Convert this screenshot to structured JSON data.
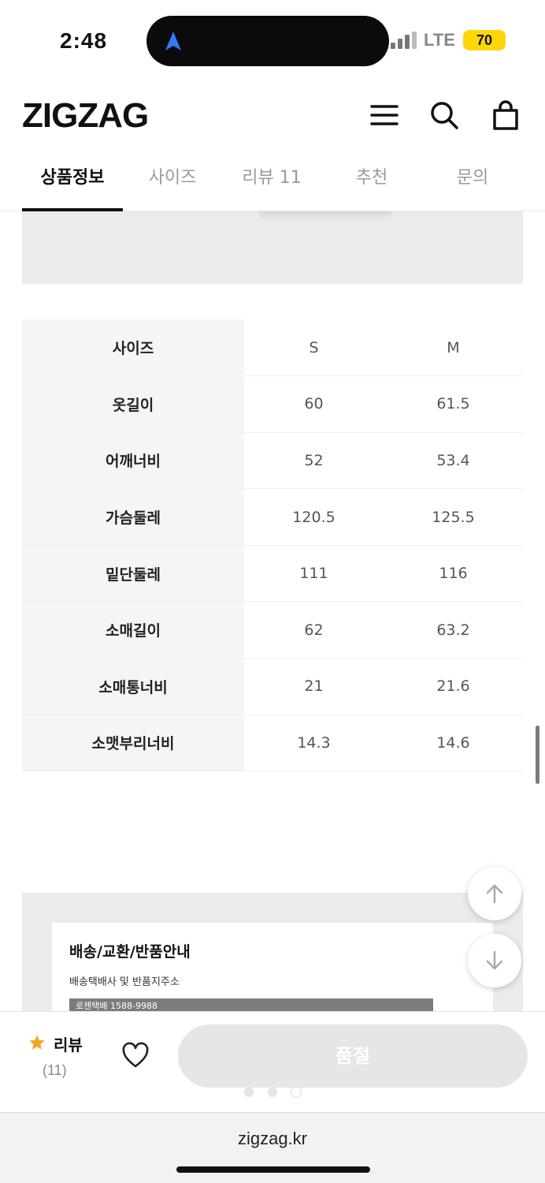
{
  "status_bar": {
    "time": "2:48",
    "carrier": "LTE",
    "battery": "70",
    "icons": [
      "location-arrow-icon",
      "signal-icon",
      "battery-icon"
    ]
  },
  "header": {
    "logo": "ZIGZAG",
    "icons": [
      "menu-icon",
      "search-icon",
      "cart-icon"
    ]
  },
  "tabs": [
    {
      "label": "상품정보",
      "active": true
    },
    {
      "label": "사이즈",
      "active": false
    },
    {
      "label": "리뷰 11",
      "active": false
    },
    {
      "label": "추천",
      "active": false
    },
    {
      "label": "문의",
      "active": false
    }
  ],
  "size_table": {
    "header": {
      "label": "사이즈",
      "s": "S",
      "m": "M"
    },
    "rows": [
      {
        "label": "옷길이",
        "s": "60",
        "m": "61.5"
      },
      {
        "label": "어깨너비",
        "s": "52",
        "m": "53.4"
      },
      {
        "label": "가슴둘레",
        "s": "120.5",
        "m": "125.5"
      },
      {
        "label": "밑단둘레",
        "s": "111",
        "m": "116"
      },
      {
        "label": "소매길이",
        "s": "62",
        "m": "63.2"
      },
      {
        "label": "소매통너비",
        "s": "21",
        "m": "21.6"
      },
      {
        "label": "소맷부리너비",
        "s": "14.3",
        "m": "14.6"
      }
    ]
  },
  "delivery": {
    "title": "배송/교환/반품안내",
    "subtitle": "배송택배사 및 반품지주소",
    "bar_text": "로젠택배 1588-9988"
  },
  "purchase_bar": {
    "review_label": "리뷰",
    "review_count": "(11)",
    "soldout_label": "품절"
  },
  "browser": {
    "url": "zigzag.kr"
  },
  "colors": {
    "accent_star": "#f5a623",
    "table_label_bg": "#f3f5f7",
    "soldout_bg": "#e6e6e6",
    "battery": "#ffd60a"
  }
}
